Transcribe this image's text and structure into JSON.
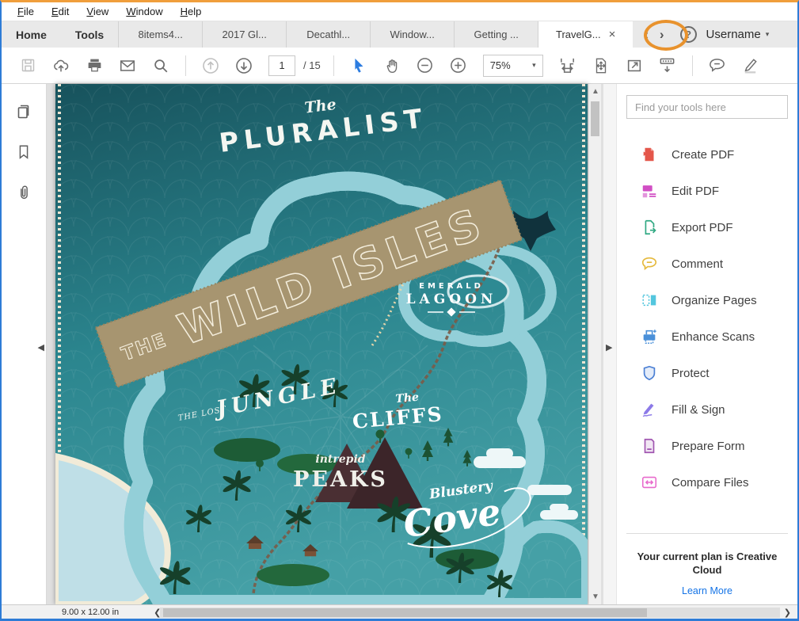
{
  "window": {
    "border_top_color": "#f09e3c",
    "border_color": "#2e7cd6",
    "annotation_color": "#e8922d"
  },
  "menu_bar": {
    "items": [
      {
        "accel": "F",
        "rest": "ile"
      },
      {
        "accel": "E",
        "rest": "dit"
      },
      {
        "accel": "V",
        "rest": "iew"
      },
      {
        "accel": "W",
        "rest": "indow"
      },
      {
        "accel": "H",
        "rest": "elp"
      }
    ]
  },
  "tab_bar": {
    "home_label": "Home",
    "tools_label": "Tools",
    "doc_tabs": [
      {
        "label": "8items4..."
      },
      {
        "label": "2017 Gl..."
      },
      {
        "label": "Decathl..."
      },
      {
        "label": "Window..."
      },
      {
        "label": "Getting ..."
      }
    ],
    "active_tab": {
      "label": "TravelG...",
      "close": "×"
    },
    "nav_prev": "‹",
    "nav_next": "›",
    "help": "?",
    "username": "Username",
    "caret": "▾"
  },
  "toolbar": {
    "page_current": "1",
    "page_total": "/ 15",
    "zoom_level": "75%",
    "cursor_color": "#2c7ce0"
  },
  "left_sidebar": {
    "icons": [
      "page-thumbnails",
      "bookmarks",
      "attachments"
    ]
  },
  "document": {
    "map": {
      "title_pre": "The",
      "title": "PLURALIST",
      "banner_pre": "THE",
      "banner": "WILD ISLES",
      "lagoon_line1": "EMERALD",
      "lagoon_line2": "LAGOON",
      "jungle_pre": "THE LOST",
      "jungle": "JUNGLE",
      "cliffs_pre": "The",
      "cliffs": "CLIFFS",
      "peaks_pre": "intrepid",
      "peaks": "PEAKS",
      "cove_pre": "Blustery",
      "cove": "Cove",
      "sea_color": "#2b858e",
      "island_color": "#3aa04e",
      "banner_color": "#a79570"
    }
  },
  "right_panel": {
    "search_placeholder": "Find your tools here",
    "tools": [
      {
        "label": "Create PDF",
        "color": "#e4564a"
      },
      {
        "label": "Edit PDF",
        "color": "#d14ec4"
      },
      {
        "label": "Export PDF",
        "color": "#2fa882"
      },
      {
        "label": "Comment",
        "color": "#e5b93c"
      },
      {
        "label": "Organize Pages",
        "color": "#53c6de"
      },
      {
        "label": "Enhance Scans",
        "color": "#4a90d9"
      },
      {
        "label": "Protect",
        "color": "#4a7fd4"
      },
      {
        "label": "Fill & Sign",
        "color": "#8c7ae8"
      },
      {
        "label": "Prepare Form",
        "color": "#a055b0"
      },
      {
        "label": "Compare Files",
        "color": "#e86acc"
      }
    ],
    "plan_text": "Your current plan is Creative Cloud",
    "learn_more": "Learn More"
  },
  "status_bar": {
    "page_dimensions": "9.00 x 12.00 in"
  }
}
